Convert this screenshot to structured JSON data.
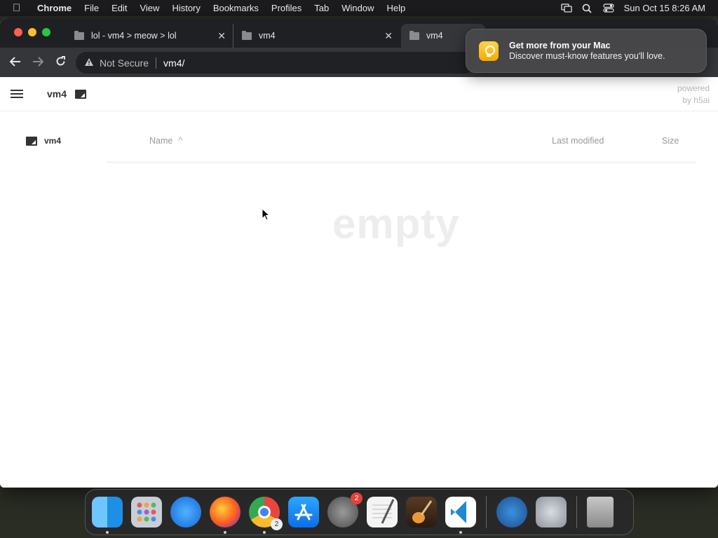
{
  "menubar": {
    "app": "Chrome",
    "items": [
      "File",
      "Edit",
      "View",
      "History",
      "Bookmarks",
      "Profiles",
      "Tab",
      "Window",
      "Help"
    ],
    "datetime": "Sun Oct 15  8:26 AM"
  },
  "tabs": [
    {
      "title": "lol - vm4 > meow > lol"
    },
    {
      "title": "vm4"
    },
    {
      "title": "vm4"
    }
  ],
  "toolbar": {
    "security": "Not Secure",
    "url": "vm4/"
  },
  "notification": {
    "title": "Get more from your Mac",
    "body": "Discover must-know features you'll love."
  },
  "page": {
    "breadcrumb": "vm4",
    "powered_line1": "powered",
    "powered_line2": "by h5ai",
    "sidebar_folder": "vm4",
    "columns": {
      "name": "Name",
      "modified": "Last modified",
      "size": "Size"
    },
    "empty_text": "empty"
  },
  "dock": {
    "settings_badge": "2",
    "chrome_badge": "2",
    "apps": [
      "finder",
      "launchpad",
      "safari",
      "firefox",
      "chrome",
      "app-store",
      "system-preferences",
      "textedit",
      "garageband",
      "vscode",
      "quicktime",
      "preferences-gear",
      "trash"
    ]
  },
  "colors": {
    "accent": "#f5a900",
    "badge": "#e5423b"
  }
}
